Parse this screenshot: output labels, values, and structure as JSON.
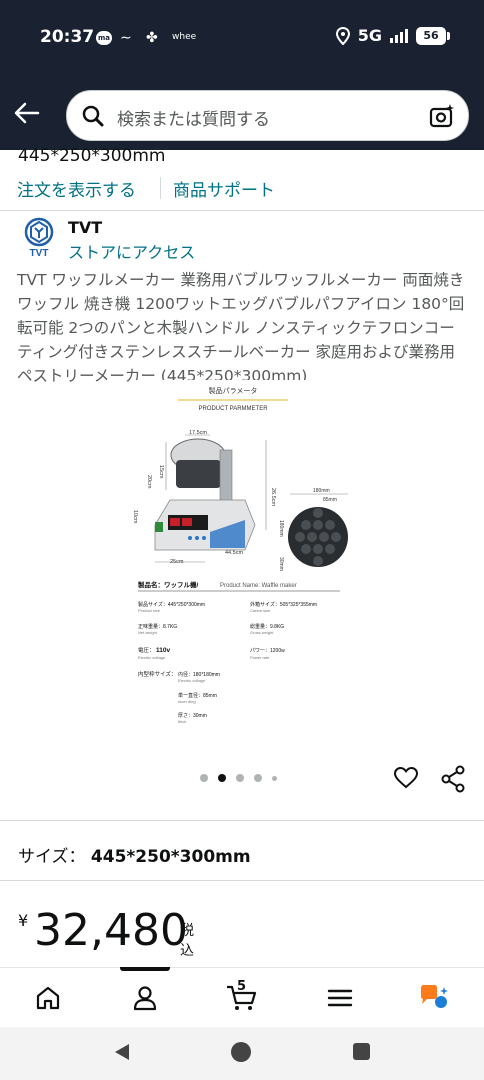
{
  "status_bar": {
    "time": "20:37",
    "notification_badge": "ma",
    "small_label": "whee",
    "network": "5G",
    "battery": "56"
  },
  "search": {
    "placeholder": "検索または質問する"
  },
  "product": {
    "size_text": "445*250*300mm",
    "order_link": "注文を表示する",
    "support_link": "商品サポート",
    "brand_name": "TVT",
    "brand_logo_text": "TVT",
    "store_link": "ストアにアクセス",
    "title": "TVT ワッフルメーカー 業務用バブルワッフルメーカー 両面焼き ワッフル 焼き機 1200ワットエッグバブルパフアイロン 180°回転可能 2つのパンと木製ハンドル ノンスティックテフロンコーティング付きステンレススチールベーカー 家庭用および業務用ペストリーメーカー (445*250*300mm)"
  },
  "image": {
    "heading_jp": "製品パラメータ",
    "heading_en": "PRODUCT PARMMETER",
    "dim_top": "17.5cm",
    "dim_left_upper": "15cm",
    "dim_left_mid": "20cm",
    "dim_left_low": "10cm",
    "dim_height": "26.5cm",
    "dim_depth": "44.5cm",
    "dim_width": "25cm",
    "plate_outer": "180mm",
    "plate_inner": "85mm",
    "plate_height": "180mm",
    "plate_thick": "30mm",
    "spec_name_label": "製品名：ワッフル機/",
    "spec_name_en": "Product Name: Waffle maker",
    "spec_size_label": "製品サイズ：445*250*300mm",
    "spec_size_en": "Product size",
    "spec_carton_label": "外箱サイズ：505*325*355mm",
    "spec_carton_en": "Carton size",
    "spec_net_label": "正味重量：8.7KG",
    "spec_net_en": "Net weight",
    "spec_gross_label": "総重量：9.8KG",
    "spec_gross_en": "Gross weight",
    "spec_voltage_label": "電圧：",
    "spec_voltage_value": "110v",
    "spec_voltage_en": "Electric voltage",
    "spec_power_label": "パワー：1200w",
    "spec_power_en": "Power rate",
    "spec_inner_label": "内型枠サイズ：",
    "spec_inner_value": "内径：180*180mm",
    "spec_inner_en": "Electric voltage",
    "spec_single_label": "単一直径：85mm",
    "spec_single_en": "inner ding",
    "spec_thick_label": "厚さ：30mm",
    "spec_thick_en": "thick"
  },
  "carousel": {
    "total": 5,
    "active_index": 2
  },
  "size_selector": {
    "label": "サイズ：",
    "value": "445*250*300mm"
  },
  "price": {
    "symbol": "¥",
    "value": "32,480",
    "tax": "税込"
  },
  "bottom_nav": {
    "cart_count": "5"
  },
  "colors": {
    "header_bg": "#1a2231",
    "link": "#007185",
    "text": "#0f1111",
    "muted": "#565959",
    "accent": "#ff9900"
  }
}
